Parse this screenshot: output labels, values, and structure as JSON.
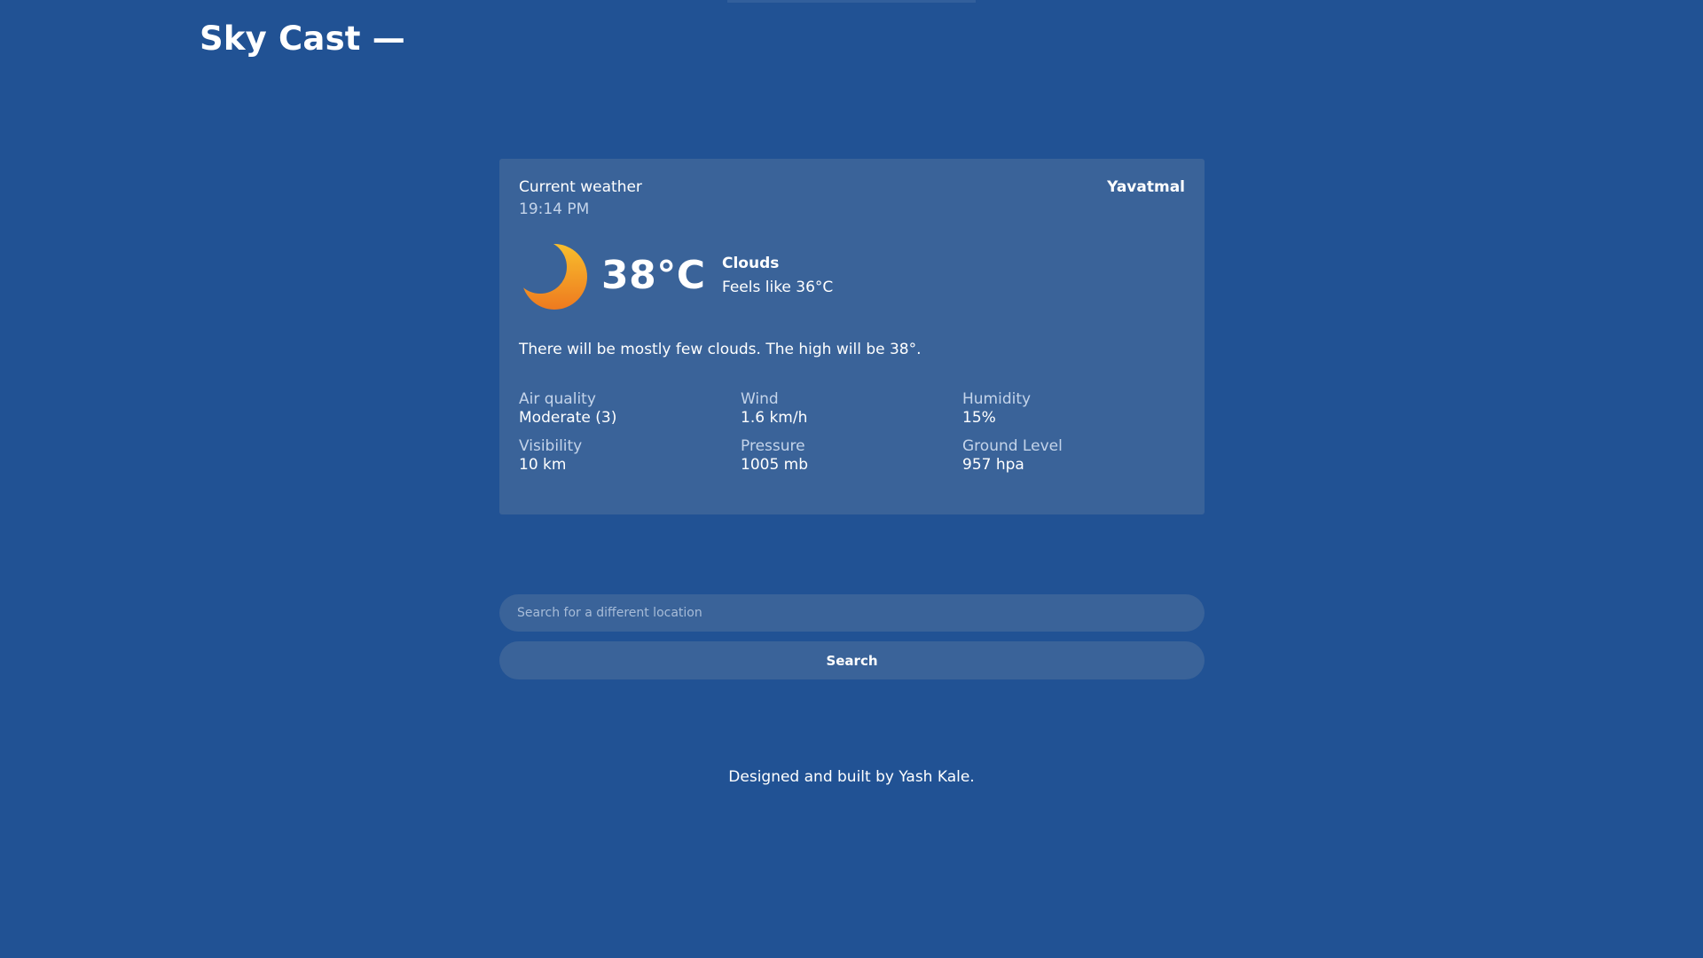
{
  "app": {
    "title": "Sky Cast —"
  },
  "weather": {
    "heading": "Current weather",
    "time": "19:14 PM",
    "location": "Yavatmal",
    "icon": "moon-icon",
    "temperature": "38°C",
    "condition": "Clouds",
    "feels_like": "Feels like 36°C",
    "summary": "There will be mostly few clouds. The high will be 38°.",
    "stats": [
      {
        "label": "Air quality",
        "value": "Moderate (3)"
      },
      {
        "label": "Wind",
        "value": "1.6 km/h"
      },
      {
        "label": "Humidity",
        "value": "15%"
      },
      {
        "label": "Visibility",
        "value": "10 km"
      },
      {
        "label": "Pressure",
        "value": "1005 mb"
      },
      {
        "label": "Ground Level",
        "value": "957 hpa"
      }
    ]
  },
  "search": {
    "placeholder": "Search for a different location",
    "value": "",
    "button_label": "Search"
  },
  "footer": {
    "text": "Designed and built by Yash Kale."
  },
  "colors": {
    "background": "#215294",
    "card": "#3a6399",
    "muted_text": "#c4d4ea",
    "moon_light": "#f7b52a",
    "moon_dark": "#ef7d1f"
  }
}
